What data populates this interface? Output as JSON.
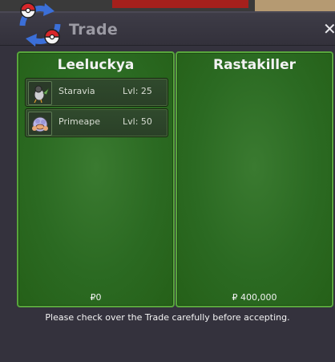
{
  "window": {
    "title": "Trade",
    "close_glyph": "✕",
    "notice": "Please check over the Trade carefully before accepting."
  },
  "left_trader": {
    "name": "Leeluckya",
    "money": "₽0",
    "pokemon": [
      {
        "name": "Staravia",
        "level": "Lvl: 25",
        "icon": "staravia-sprite-icon"
      },
      {
        "name": "Primeape",
        "level": "Lvl: 50",
        "icon": "primeape-sprite-icon"
      }
    ]
  },
  "right_trader": {
    "name": "Rastakiller",
    "money": "₽ 400,000",
    "pokemon": []
  },
  "colors": {
    "panel_green": "#2b6a22",
    "panel_border": "#58a63c",
    "window_bg": "#34323d",
    "text_light": "#f2f2f2",
    "title_gray": "#9b9aa3"
  },
  "icons": [
    "trade-arrows-icon",
    "pokeball-icon",
    "close-icon"
  ]
}
